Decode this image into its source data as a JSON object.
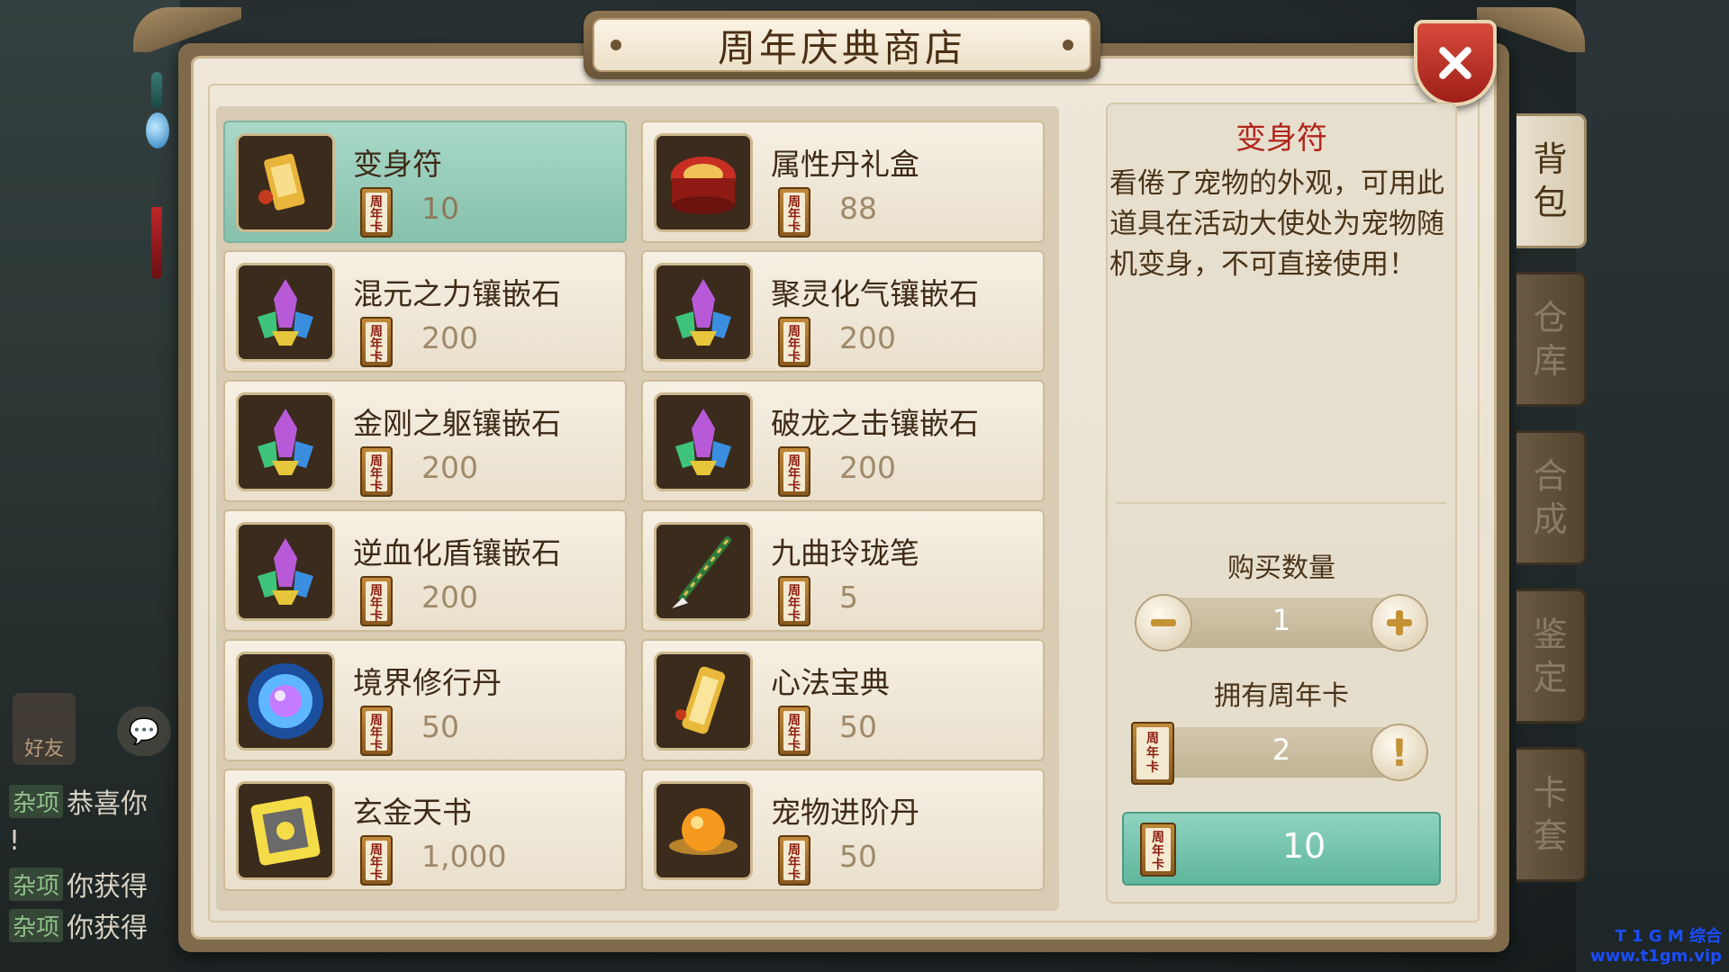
{
  "window": {
    "title": "周年庆典商店"
  },
  "colors": {
    "selected_item": "#9ccfbb",
    "detail_title": "#b0261c",
    "buy_button": "#74c6ae"
  },
  "items": [
    {
      "name": "变身符",
      "price": "10",
      "icon": "transform-talisman-icon",
      "selected": true
    },
    {
      "name": "属性丹礼盒",
      "price": "88",
      "icon": "pill-giftbox-icon",
      "selected": false
    },
    {
      "name": "混元之力镶嵌石",
      "price": "200",
      "icon": "crystal-gem-icon",
      "selected": false
    },
    {
      "name": "聚灵化气镶嵌石",
      "price": "200",
      "icon": "crystal-gem-icon",
      "selected": false
    },
    {
      "name": "金刚之躯镶嵌石",
      "price": "200",
      "icon": "crystal-gem-icon",
      "selected": false
    },
    {
      "name": "破龙之击镶嵌石",
      "price": "200",
      "icon": "crystal-gem-icon",
      "selected": false
    },
    {
      "name": "逆血化盾镶嵌石",
      "price": "200",
      "icon": "crystal-gem-icon",
      "selected": false
    },
    {
      "name": "九曲玲珑笔",
      "price": "5",
      "icon": "brush-pen-icon",
      "selected": false
    },
    {
      "name": "境界修行丹",
      "price": "50",
      "icon": "glowing-orb-icon",
      "selected": false
    },
    {
      "name": "心法宝典",
      "price": "50",
      "icon": "scroll-book-icon",
      "selected": false
    },
    {
      "name": "玄金天书",
      "price": "1,000",
      "icon": "golden-book-icon",
      "selected": false
    },
    {
      "name": "宠物进阶丹",
      "price": "50",
      "icon": "pet-pill-icon",
      "selected": false
    }
  ],
  "currency": {
    "ticket_line1": "周",
    "ticket_line2": "年",
    "ticket_line3": "卡",
    "icon": "anniversary-card-icon"
  },
  "detail": {
    "title": "变身符",
    "description": "看倦了宠物的外观，可用此道具在活动大使处为宠物随机变身，不可直接使用！",
    "quantity_label": "购买数量",
    "quantity": "1",
    "owned_label": "拥有周年卡",
    "owned": "2",
    "total_price": "10"
  },
  "side_tabs": [
    {
      "line1": "背",
      "line2": "包",
      "active": true
    },
    {
      "line1": "仓",
      "line2": "库",
      "active": false
    },
    {
      "line1": "合",
      "line2": "成",
      "active": false
    },
    {
      "line1": "鉴",
      "line2": "定",
      "active": false
    },
    {
      "line1": "卡",
      "line2": "套",
      "active": false
    }
  ],
  "background": {
    "friend_label": "好友",
    "chat": [
      {
        "tag": "杂项",
        "text": "恭喜你"
      },
      {
        "tag": "",
        "text": "!"
      },
      {
        "tag": "杂项",
        "text": "你获得"
      },
      {
        "tag": "杂项",
        "text": "你获得"
      }
    ]
  },
  "watermark": {
    "line1": "T 1 G M 综合",
    "line2": "www.t1gm.vip"
  }
}
